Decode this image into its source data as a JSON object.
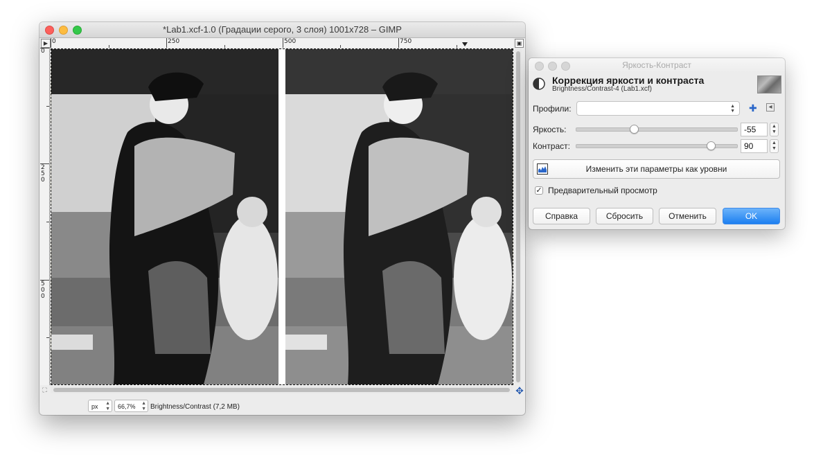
{
  "image_window": {
    "title": "*Lab1.xcf-1.0 (Градации серого, 3 слоя) 1001x728 – GIMP",
    "hruler_labels": [
      "0",
      "250",
      "500",
      "750"
    ],
    "vruler_labels": [
      "0",
      "250",
      "500"
    ],
    "nav_icon": "navigate-icon",
    "menu_icon": "menu-triangle-icon",
    "zoom_icon": "zoom-fit-icon",
    "move_icon": "move-icon",
    "unit": "px",
    "zoom": "66,7%",
    "status": "Brightness/Contrast (7,2 MB)"
  },
  "dialog": {
    "title": "Яркость-Контраст",
    "header_title": "Коррекция яркости и контраста",
    "header_subtitle": "Brightness/Contrast-4 (Lab1.xcf)",
    "presets_label": "Профили:",
    "presets_value": "",
    "add_preset_icon": "add-preset-icon",
    "preset_menu_icon": "preset-menu-icon",
    "brightness_label": "Яркость:",
    "brightness_value": "-55",
    "brightness_fraction": 0.36,
    "contrast_label": "Контраст:",
    "contrast_value": "90",
    "contrast_fraction": 0.84,
    "levels_button": "Изменить эти параметры как уровни",
    "preview_label": "Предварительный просмотр",
    "preview_checked": true,
    "buttons": {
      "help": "Справка",
      "reset": "Сбросить",
      "cancel": "Отменить",
      "ok": "OK"
    }
  }
}
